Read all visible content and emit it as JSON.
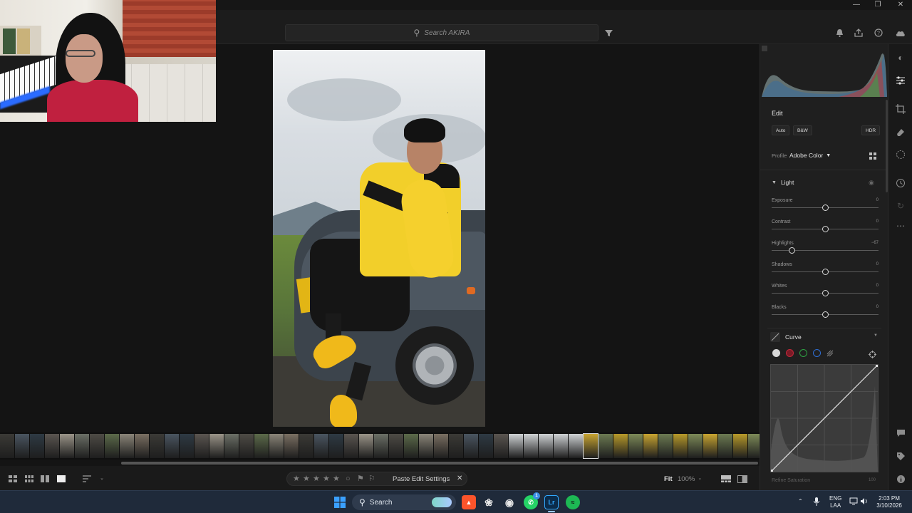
{
  "window": {
    "minimize": "—",
    "restore": "❐",
    "close": "✕"
  },
  "search": {
    "placeholder": "Search AKIRA"
  },
  "top_icons": [
    "filter-icon",
    "bell-icon",
    "share-icon",
    "help-icon",
    "cloud-icon"
  ],
  "edit_panel": {
    "title": "Edit",
    "auto_label": "Auto",
    "bw_label": "B&W",
    "hdr_label": "HDR",
    "profile_label": "Profile",
    "profile_value": "Adobe Color",
    "light_section": "Light",
    "sliders": [
      {
        "label": "Exposure",
        "value": "0",
        "fraction": 0.5
      },
      {
        "label": "Contrast",
        "value": "0",
        "fraction": 0.5
      },
      {
        "label": "Highlights",
        "value": "−67",
        "fraction": 0.19
      },
      {
        "label": "Shadows",
        "value": "0",
        "fraction": 0.5
      },
      {
        "label": "Whites",
        "value": "0",
        "fraction": 0.5
      },
      {
        "label": "Blacks",
        "value": "0",
        "fraction": 0.5
      }
    ],
    "curve_section": "Curve",
    "curve_channel_colors": [
      "#d8d8d8",
      "#c0283a",
      "#2ea043",
      "#2f6fd6"
    ],
    "refine_saturation": "Refine Saturation",
    "refine_value": "100"
  },
  "bottom_toolbar": {
    "paste_label": "Paste Edit Settings",
    "fit_label": "Fit",
    "zoom_value": "100%"
  },
  "taskbar": {
    "search_label": "Search",
    "lang_top": "ENG",
    "lang_bottom": "LAA",
    "time": "2:03 PM",
    "date": "3/10/2026",
    "lr_label": "Lr",
    "whatsapp_badge": "1"
  }
}
